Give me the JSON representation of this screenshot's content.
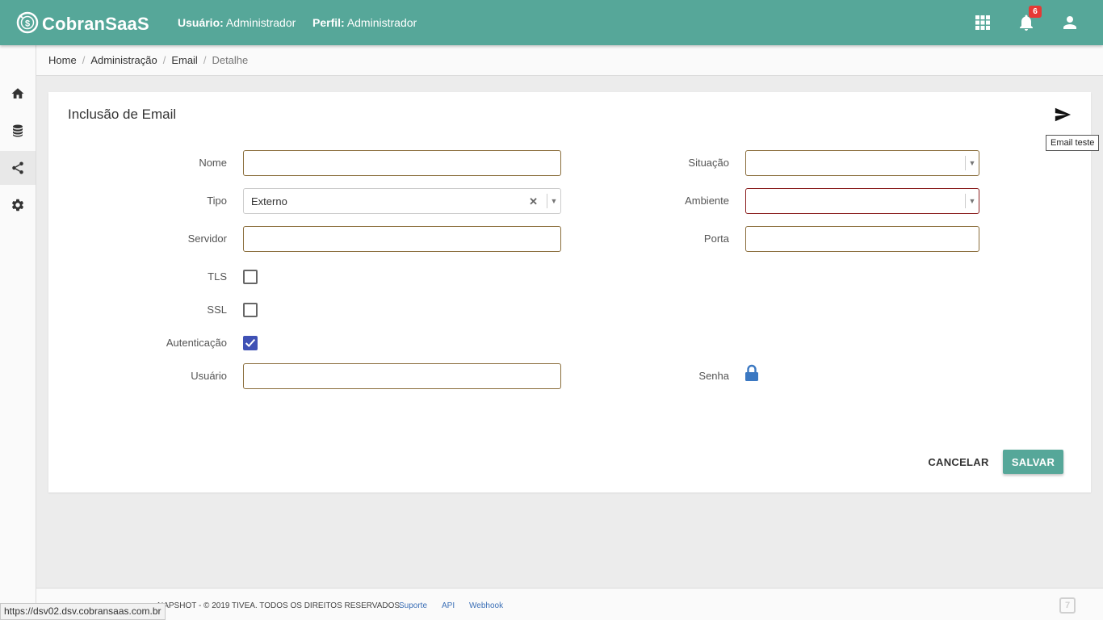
{
  "header": {
    "app_name": "CobranSaaS",
    "user_label": "Usuário:",
    "user_value": "Administrador",
    "perfil_label": "Perfil:",
    "perfil_value": "Administrador",
    "notifications_count": "6",
    "brand_color": "#56a799"
  },
  "sidebar": {
    "items": [
      {
        "icon": "home-icon"
      },
      {
        "icon": "database-icon"
      },
      {
        "icon": "share-icon",
        "active": true
      },
      {
        "icon": "gear-icon"
      }
    ]
  },
  "breadcrumb": {
    "items": [
      "Home",
      "Administração",
      "Email"
    ],
    "current": "Detalhe"
  },
  "form": {
    "title": "Inclusão de Email",
    "send_tooltip": "Email teste",
    "nome_label": "Nome",
    "nome_value": "",
    "tipo_label": "Tipo",
    "tipo_value": "Externo",
    "servidor_label": "Servidor",
    "servidor_value": "",
    "tls_label": "TLS",
    "tls_checked": false,
    "ssl_label": "SSL",
    "ssl_checked": false,
    "autenticacao_label": "Autenticação",
    "autenticacao_checked": true,
    "usuario_label": "Usuário",
    "usuario_value": "",
    "situacao_label": "Situação",
    "situacao_value": "",
    "ambiente_label": "Ambiente",
    "ambiente_value": "",
    "porta_label": "Porta",
    "porta_value": "",
    "senha_label": "Senha",
    "cancel_label": "CANCELAR",
    "save_label": "SALVAR"
  },
  "footer": {
    "copyright": "NAPSHOT - © 2019 TIVEA. TODOS OS DIREITOS RESERVADOS.",
    "links": [
      "Suporte",
      "API",
      "Webhook"
    ]
  },
  "status_bar": {
    "url": "https://dsv02.dsv.cobransaas.com.br"
  }
}
